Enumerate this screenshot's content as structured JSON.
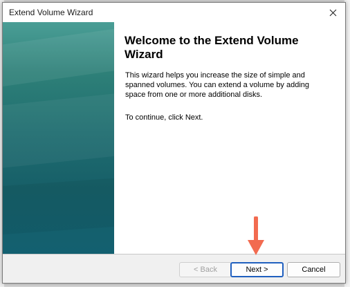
{
  "window": {
    "title": "Extend Volume Wizard",
    "close_icon": "close-icon"
  },
  "content": {
    "heading": "Welcome to the Extend Volume Wizard",
    "description": "This wizard helps you increase the size of simple and spanned volumes. You can extend a volume  by adding space from one or more additional disks.",
    "instruction": "To continue, click Next."
  },
  "buttons": {
    "back_label": "< Back",
    "next_label": "Next >",
    "cancel_label": "Cancel"
  },
  "annotation": {
    "icon": "arrow-down-icon",
    "color": "#f26b50"
  },
  "colors": {
    "banner_top": "#4a9e96",
    "banner_bottom": "#136070",
    "default_button_border": "#1f5fbf"
  }
}
